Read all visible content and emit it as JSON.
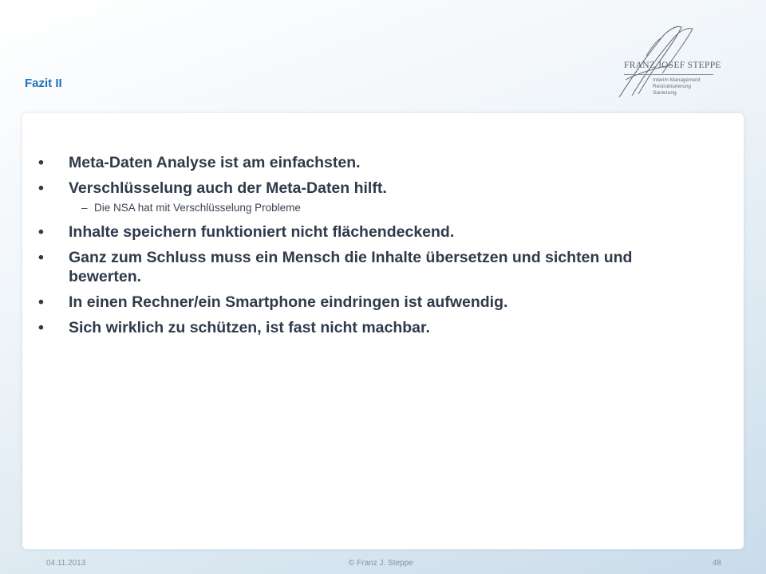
{
  "slide": {
    "title": "Fazit II"
  },
  "logo": {
    "name": "FRANZ JOSEF STEPPE",
    "tagline_lines": [
      "Interim Management",
      "Restrukturierung",
      "Sanierung"
    ]
  },
  "content": {
    "bullets": [
      {
        "marker": "•",
        "text": "Meta-Daten Analyse ist am einfachsten."
      },
      {
        "marker": "•",
        "text": "Verschlüsselung auch der Meta-Daten hilft.",
        "sub": {
          "marker": "–",
          "text": "Die NSA hat mit Verschlüsselung Probleme"
        }
      },
      {
        "marker": "•",
        "text": "Inhalte speichern funktioniert nicht flächendeckend."
      },
      {
        "marker": "•",
        "text": "Ganz zum Schluss muss ein Mensch die Inhalte übersetzen und sichten und bewerten."
      },
      {
        "marker": "•",
        "text": "In einen Rechner/ein Smartphone eindringen ist aufwendig."
      },
      {
        "marker": "•",
        "text": "Sich wirklich zu schützen, ist fast nicht machbar."
      }
    ]
  },
  "footer": {
    "date": "04.11.2013",
    "copyright": "© Franz J. Steppe",
    "page_number": "48"
  },
  "colors": {
    "title": "#1f72b8",
    "body_text": "#2f3a4a",
    "footer_text": "#7f93a8",
    "background_gradient_end": "#c9dcea"
  }
}
